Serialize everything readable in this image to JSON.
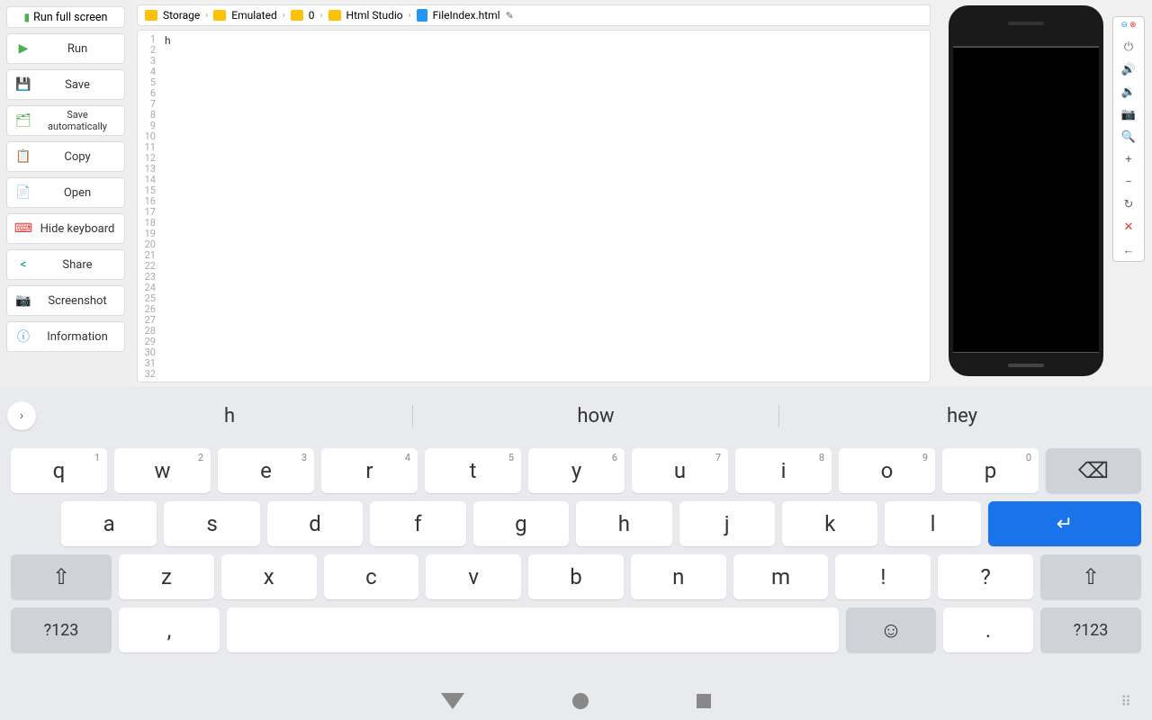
{
  "sidebar": {
    "fullscreen": "Run full screen",
    "run": "Run",
    "save": "Save",
    "autosave": "Save automatically",
    "copy": "Copy",
    "open": "Open",
    "hidekbd": "Hide keyboard",
    "share": "Share",
    "screenshot": "Screenshot",
    "info": "Information"
  },
  "breadcrumbs": [
    "Storage",
    "Emulated",
    "0",
    "Html Studio",
    "FileIndex.html"
  ],
  "editor": {
    "line_count": 32,
    "content_line1": "h"
  },
  "keyboard": {
    "suggestions": [
      "h",
      "how",
      "hey"
    ],
    "row1": [
      {
        "k": "q",
        "n": "1"
      },
      {
        "k": "w",
        "n": "2"
      },
      {
        "k": "e",
        "n": "3"
      },
      {
        "k": "r",
        "n": "4"
      },
      {
        "k": "t",
        "n": "5"
      },
      {
        "k": "y",
        "n": "6"
      },
      {
        "k": "u",
        "n": "7"
      },
      {
        "k": "i",
        "n": "8"
      },
      {
        "k": "o",
        "n": "9"
      },
      {
        "k": "p",
        "n": "0"
      }
    ],
    "row2": [
      "a",
      "s",
      "d",
      "f",
      "g",
      "h",
      "j",
      "k",
      "l"
    ],
    "row3": [
      "z",
      "x",
      "c",
      "v",
      "b",
      "n",
      "m",
      "!",
      "?"
    ],
    "row4": {
      "symkey": "?123",
      "comma": ",",
      "period": ".",
      "symkey2": "?123"
    }
  }
}
